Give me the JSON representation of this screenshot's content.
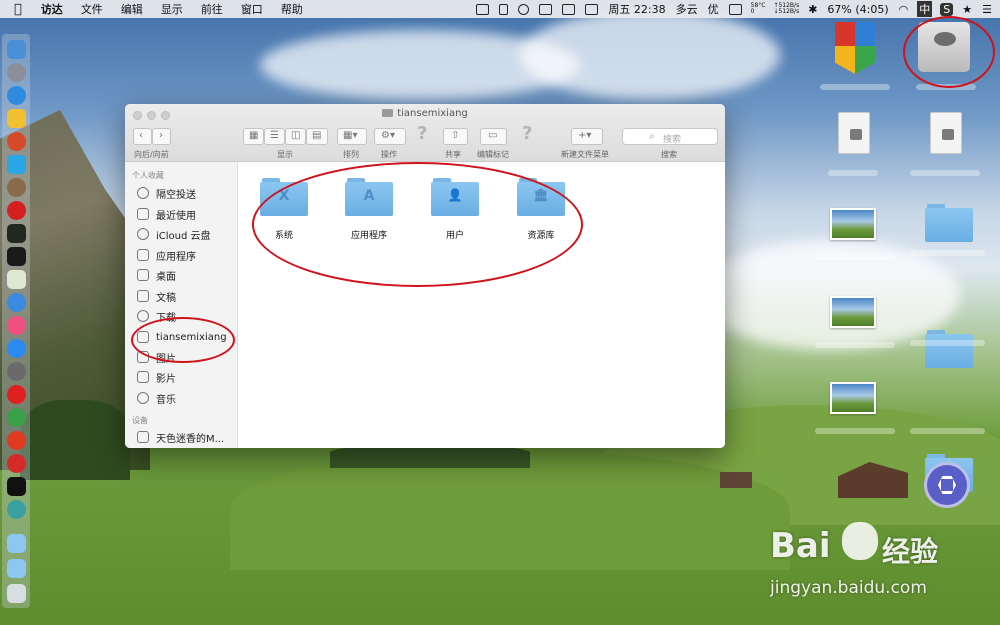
{
  "menubar": {
    "apple_icon": "apple-logo-icon",
    "app_name": "访达",
    "menus": [
      "文件",
      "编辑",
      "显示",
      "前往",
      "窗口",
      "帮助"
    ],
    "datetime": "周五 22:38",
    "weather": "多云",
    "user_char": "优",
    "temp": "58°C",
    "temp_val": "0",
    "net_up": "↑512B/s",
    "net_down": "↓512B/s",
    "battery": "67% (4:05)",
    "input_method": "中",
    "app_s": "S"
  },
  "window": {
    "title": "tiansemixiang",
    "toolbar": {
      "nav_label": "向后/向前",
      "view_label": "显示",
      "arrange_label": "排列",
      "action_label": "操作",
      "share_label": "共享",
      "tags_label": "编辑标记",
      "new_folder_menu_label": "新建文件菜单",
      "search_label": "搜索",
      "search_placeholder": "搜索"
    },
    "sidebar": {
      "favorites_header": "个人收藏",
      "devices_header": "设备",
      "items": [
        {
          "label": "隔空投送",
          "icon": "airdrop-icon"
        },
        {
          "label": "最近使用",
          "icon": "recents-icon"
        },
        {
          "label": "iCloud 云盘",
          "icon": "cloud-icon"
        },
        {
          "label": "应用程序",
          "icon": "applications-icon"
        },
        {
          "label": "桌面",
          "icon": "desktop-icon"
        },
        {
          "label": "文稿",
          "icon": "documents-icon"
        },
        {
          "label": "下载",
          "icon": "download-icon"
        },
        {
          "label": "tiansemixiang",
          "icon": "home-icon"
        },
        {
          "label": "图片",
          "icon": "pictures-icon"
        },
        {
          "label": "影片",
          "icon": "movies-icon"
        },
        {
          "label": "音乐",
          "icon": "music-icon"
        }
      ],
      "device": {
        "label": "天色迷香的M...",
        "icon": "laptop-icon"
      }
    },
    "folders": [
      {
        "label": "系统",
        "emblem": "X"
      },
      {
        "label": "应用程序",
        "emblem": "A"
      },
      {
        "label": "用户",
        "emblem": "👤"
      },
      {
        "label": "资源库",
        "emblem": "🏛"
      }
    ]
  },
  "watermark": {
    "brand": "Bai",
    "brand_cn": "经验",
    "url": "jingyan.baidu.com"
  },
  "colors": {
    "annotation_red": "#d0121b",
    "folder_blue": "#7ab9e9",
    "menubar_bg": "#ebebee"
  }
}
